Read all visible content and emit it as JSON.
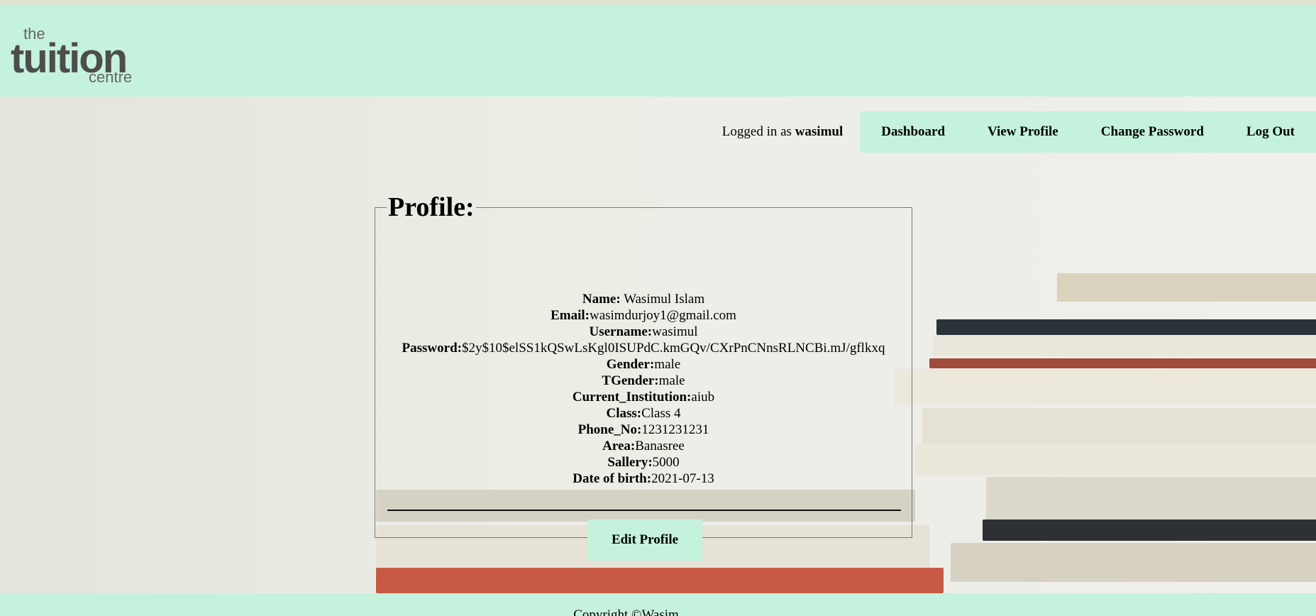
{
  "header": {
    "logo": {
      "top": "the",
      "word": "tuition",
      "bottom": "centre"
    }
  },
  "nav": {
    "logged_prefix": "Logged in as",
    "username": "wasimul",
    "links": [
      "Dashboard",
      "View Profile",
      "Change Password",
      "Log Out"
    ]
  },
  "profile": {
    "legend": "Profile:",
    "fields": [
      {
        "label": "Name:",
        "value": " Wasimul Islam"
      },
      {
        "label": "Email:",
        "value": "wasimdurjoy1@gmail.com"
      },
      {
        "label": "Username:",
        "value": "wasimul"
      },
      {
        "label": "Password:",
        "value": "$2y$10$elSS1kQSwLsKgl0ISUPdC.kmGQv/CXrPnCNnsRLNCBi.mJ/gflkxq"
      },
      {
        "label": "Gender:",
        "value": "male"
      },
      {
        "label": "TGender:",
        "value": "male"
      },
      {
        "label": "Current_Institution:",
        "value": "aiub"
      },
      {
        "label": "Class:",
        "value": "Class 4"
      },
      {
        "label": "Phone_No:",
        "value": "1231231231"
      },
      {
        "label": "Area:",
        "value": "Banasree"
      },
      {
        "label": "Sallery:",
        "value": "5000"
      },
      {
        "label": "Date of birth:",
        "value": "2021-07-13"
      }
    ],
    "edit_button": "Edit Profile"
  },
  "footer": {
    "copyright": "Copyright ©Wasim"
  },
  "colors": {
    "accent": "#c5f2dc"
  }
}
